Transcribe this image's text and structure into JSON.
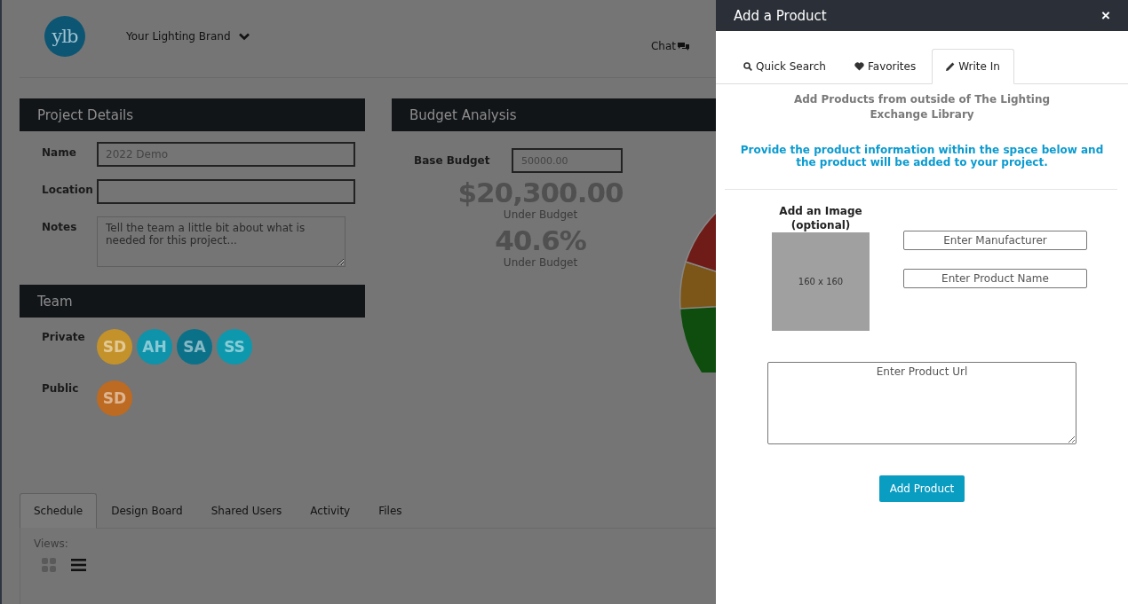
{
  "header": {
    "logo": "ylb",
    "brand": "Your Lighting Brand",
    "chat": "Chat"
  },
  "project_details": {
    "title": "Project Details",
    "name_label": "Name",
    "name_value": "2022 Demo",
    "location_label": "Location",
    "notes_label": "Notes",
    "notes_placeholder": "Tell the team a little bit about what is needed for this project..."
  },
  "team": {
    "title": "Team",
    "groups": [
      {
        "label": "Private",
        "members": [
          {
            "initials": "SD",
            "color": "#c4922a"
          },
          {
            "initials": "AH",
            "color": "#0e93aa"
          },
          {
            "initials": "SA",
            "color": "#0b7189"
          },
          {
            "initials": "SS",
            "color": "#0e98ad"
          }
        ]
      },
      {
        "label": "Public",
        "members": [
          {
            "initials": "SD",
            "color": "#bd6a22"
          }
        ]
      }
    ]
  },
  "budget": {
    "title": "Budget Analysis",
    "base_label": "Base Budget",
    "base_value": "50000.00",
    "amount": "$20,300.00",
    "amount_caption": "Under Budget",
    "percent": "40.6%",
    "percent_caption": "Under Budget"
  },
  "tabs": [
    {
      "label": "Schedule",
      "selected": true
    },
    {
      "label": "Design Board",
      "selected": false
    },
    {
      "label": "Shared Users",
      "selected": false
    },
    {
      "label": "Activity",
      "selected": false
    },
    {
      "label": "Files",
      "selected": false
    }
  ],
  "views": {
    "label": "Views:",
    "options": [
      {
        "kind": "grid",
        "selected": false
      },
      {
        "kind": "list",
        "selected": true
      }
    ]
  },
  "drawer": {
    "title": "Add a Product",
    "close": "×",
    "tabs": [
      {
        "label": "Quick Search",
        "kind": "search",
        "selected": false
      },
      {
        "label": "Favorites",
        "kind": "heart",
        "selected": false
      },
      {
        "label": "Write In",
        "kind": "pencil",
        "selected": true
      }
    ],
    "intro": "Add Products from outside of The Lighting Exchange Library",
    "instruction": "Provide the product information within the space below and the product will be added to your project.",
    "image_label": "Add an Image (optional)",
    "image_size": "160 x 160",
    "manufacturer_placeholder": "Enter Manufacturer",
    "product_name_placeholder": "Enter Product Name",
    "url_placeholder": "Enter Product Url",
    "submit": "Add Product"
  }
}
